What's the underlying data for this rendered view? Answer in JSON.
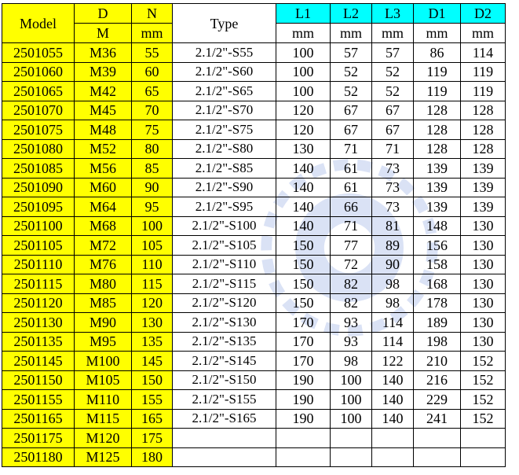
{
  "header": {
    "model": "Model",
    "d": "D",
    "d_unit": "M",
    "n": "N",
    "n_unit": "mm",
    "type": "Type",
    "l1": "L1",
    "l2": "L2",
    "l3": "L3",
    "d1": "D1",
    "d2": "D2",
    "unit_mm": "mm"
  },
  "colors": {
    "yellow": "#ffff00",
    "cyan": "#00ffff"
  },
  "rows": [
    {
      "model": "2501055",
      "d": "M36",
      "n": "55",
      "type": "2.1/2\"-S55",
      "l1": "100",
      "l2": "57",
      "l3": "57",
      "d1": "86",
      "d2": "114"
    },
    {
      "model": "2501060",
      "d": "M39",
      "n": "60",
      "type": "2.1/2\"-S60",
      "l1": "100",
      "l2": "52",
      "l3": "52",
      "d1": "119",
      "d2": "119"
    },
    {
      "model": "2501065",
      "d": "M42",
      "n": "65",
      "type": "2.1/2\"-S65",
      "l1": "100",
      "l2": "52",
      "l3": "52",
      "d1": "119",
      "d2": "119"
    },
    {
      "model": "2501070",
      "d": "M45",
      "n": "70",
      "type": "2.1/2\"-S70",
      "l1": "120",
      "l2": "67",
      "l3": "67",
      "d1": "128",
      "d2": "128"
    },
    {
      "model": "2501075",
      "d": "M48",
      "n": "75",
      "type": "2.1/2\"-S75",
      "l1": "120",
      "l2": "67",
      "l3": "67",
      "d1": "128",
      "d2": "128"
    },
    {
      "model": "2501080",
      "d": "M52",
      "n": "80",
      "type": "2.1/2\"-S80",
      "l1": "130",
      "l2": "71",
      "l3": "71",
      "d1": "128",
      "d2": "128"
    },
    {
      "model": "2501085",
      "d": "M56",
      "n": "85",
      "type": "2.1/2\"-S85",
      "l1": "140",
      "l2": "61",
      "l3": "73",
      "d1": "139",
      "d2": "139"
    },
    {
      "model": "2501090",
      "d": "M60",
      "n": "90",
      "type": "2.1/2\"-S90",
      "l1": "140",
      "l2": "61",
      "l3": "73",
      "d1": "139",
      "d2": "139"
    },
    {
      "model": "2501095",
      "d": "M64",
      "n": "95",
      "type": "2.1/2\"-S95",
      "l1": "140",
      "l2": "66",
      "l3": "73",
      "d1": "139",
      "d2": "139"
    },
    {
      "model": "2501100",
      "d": "M68",
      "n": "100",
      "type": "2.1/2\"-S100",
      "l1": "140",
      "l2": "71",
      "l3": "81",
      "d1": "148",
      "d2": "130"
    },
    {
      "model": "2501105",
      "d": "M72",
      "n": "105",
      "type": "2.1/2\"-S105",
      "l1": "150",
      "l2": "77",
      "l3": "89",
      "d1": "156",
      "d2": "130"
    },
    {
      "model": "2501110",
      "d": "M76",
      "n": "110",
      "type": "2.1/2\"-S110",
      "l1": "150",
      "l2": "72",
      "l3": "90",
      "d1": "158",
      "d2": "130"
    },
    {
      "model": "2501115",
      "d": "M80",
      "n": "115",
      "type": "2.1/2\"-S115",
      "l1": "150",
      "l2": "82",
      "l3": "98",
      "d1": "168",
      "d2": "130"
    },
    {
      "model": "2501120",
      "d": "M85",
      "n": "120",
      "type": "2.1/2\"-S120",
      "l1": "150",
      "l2": "82",
      "l3": "98",
      "d1": "178",
      "d2": "130"
    },
    {
      "model": "2501130",
      "d": "M90",
      "n": "130",
      "type": "2.1/2\"-S130",
      "l1": "170",
      "l2": "93",
      "l3": "114",
      "d1": "189",
      "d2": "130"
    },
    {
      "model": "2501135",
      "d": "M95",
      "n": "135",
      "type": "2.1/2\"-S135",
      "l1": "170",
      "l2": "93",
      "l3": "114",
      "d1": "198",
      "d2": "130"
    },
    {
      "model": "2501145",
      "d": "M100",
      "n": "145",
      "type": "2.1/2\"-S145",
      "l1": "170",
      "l2": "98",
      "l3": "122",
      "d1": "210",
      "d2": "152"
    },
    {
      "model": "2501150",
      "d": "M105",
      "n": "150",
      "type": "2.1/2\"-S150",
      "l1": "190",
      "l2": "100",
      "l3": "140",
      "d1": "216",
      "d2": "152"
    },
    {
      "model": "2501155",
      "d": "M110",
      "n": "155",
      "type": "2.1/2\"-S155",
      "l1": "190",
      "l2": "100",
      "l3": "140",
      "d1": "229",
      "d2": "152"
    },
    {
      "model": "2501165",
      "d": "M115",
      "n": "165",
      "type": "2.1/2\"-S165",
      "l1": "190",
      "l2": "100",
      "l3": "140",
      "d1": "241",
      "d2": "152"
    },
    {
      "model": "2501175",
      "d": "M120",
      "n": "175",
      "type": "",
      "l1": "",
      "l2": "",
      "l3": "",
      "d1": "",
      "d2": ""
    },
    {
      "model": "2501180",
      "d": "M125",
      "n": "180",
      "type": "",
      "l1": "",
      "l2": "",
      "l3": "",
      "d1": "",
      "d2": ""
    }
  ]
}
